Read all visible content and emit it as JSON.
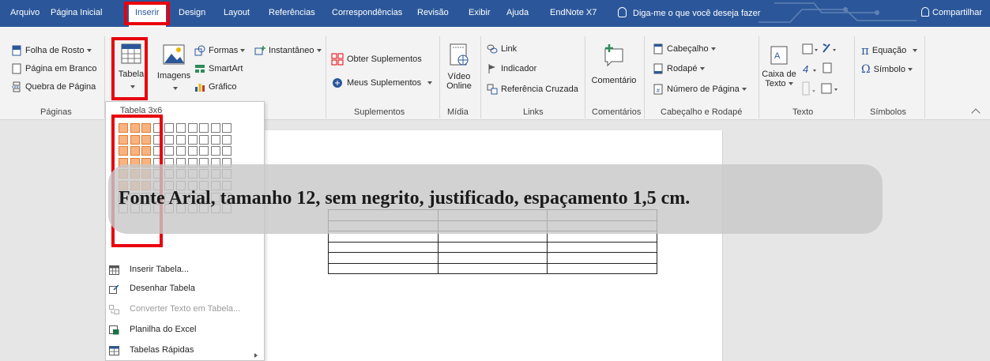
{
  "tabs": [
    "Arquivo",
    "Página Inicial",
    "Inserir",
    "Design",
    "Layout",
    "Referências",
    "Correspondências",
    "Revisão",
    "Exibir",
    "Ajuda",
    "EndNote X7"
  ],
  "active_tab": "Inserir",
  "tell_me": "Diga-me o que você deseja fazer",
  "share": "Compartilhar",
  "ribbon": {
    "paginas": {
      "items": [
        "Folha de Rosto",
        "Página em Branco",
        "Quebra de Página"
      ],
      "label": "Páginas"
    },
    "tabelas": {
      "tabela": "Tabela"
    },
    "ilustracoes": {
      "imagens": "Imagens",
      "formas": "Formas",
      "smartart": "SmartArt",
      "grafico": "Gráfico",
      "instantaneo": "Instantâneo"
    },
    "suplementos": {
      "obter": "Obter Suplementos",
      "meus": "Meus Suplementos",
      "label": "Suplementos"
    },
    "midia": {
      "video_line1": "Vídeo",
      "video_line2": "Online",
      "label": "Mídia"
    },
    "links": {
      "items": [
        "Link",
        "Indicador",
        "Referência Cruzada"
      ],
      "label": "Links"
    },
    "comentarios": {
      "comentario": "Comentário",
      "label": "Comentários"
    },
    "cabecalho_rodape": {
      "items": [
        "Cabeçalho",
        "Rodapé",
        "Número de Página"
      ],
      "label": "Cabeçalho e Rodapé"
    },
    "texto": {
      "caixa_line1": "Caixa de",
      "caixa_line2": "Texto",
      "label": "Texto"
    },
    "simbolos": {
      "equacao": "Equação",
      "simbolo": "Símbolo",
      "label": "Símbolos"
    }
  },
  "table_menu": {
    "title": "Tabela 3x6",
    "grid_rows": 8,
    "grid_cols": 10,
    "selected_cols": 3,
    "selected_rows": 6,
    "items": [
      {
        "label": "Inserir Tabela...",
        "enabled": true
      },
      {
        "label": "Desenhar Tabela",
        "enabled": true
      },
      {
        "label": "Converter Texto em Tabela...",
        "enabled": false
      },
      {
        "label": "Planilha do Excel",
        "enabled": true
      },
      {
        "label": "Tabelas Rápidas",
        "enabled": true
      }
    ]
  },
  "document_table": {
    "rows": 6,
    "cols": 3
  },
  "callout": "Fonte Arial, tamanho 12, sem negrito, justificado, espaçamento 1,5 cm.",
  "colors": {
    "accent": "#2b579a",
    "highlight": "#e8000d",
    "grid_selected": "#f9b380"
  }
}
